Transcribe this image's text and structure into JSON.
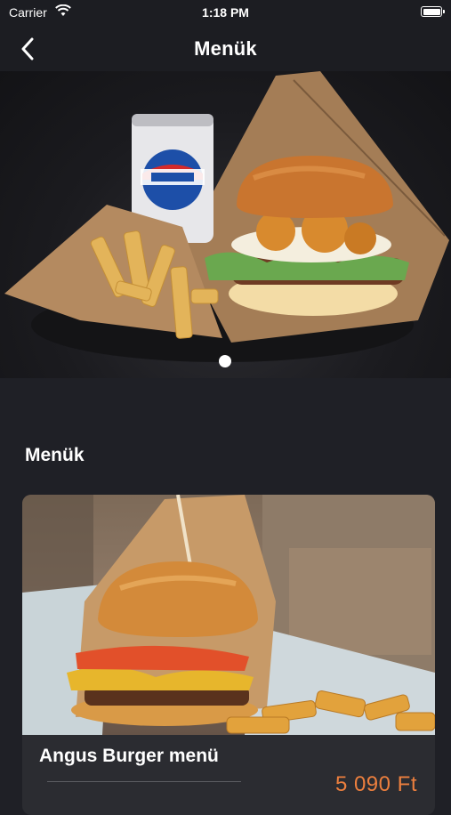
{
  "status_bar": {
    "carrier": "Carrier",
    "time": "1:18 PM",
    "icons": [
      "wifi-icon",
      "battery-icon"
    ]
  },
  "nav": {
    "title": "Menük",
    "back_icon": "chevron-left-icon"
  },
  "hero": {
    "images": [
      "pepsi-burger-fries-combo"
    ],
    "active_index": 0
  },
  "section": {
    "title": "Menük"
  },
  "menu_items": [
    {
      "name": "Angus Burger menü",
      "price": "5 090 Ft",
      "image": "angus-burger-fries"
    }
  ],
  "colors": {
    "background": "#1f2026",
    "card": "#2b2c31",
    "price": "#ec7f3e",
    "text": "#ffffff"
  }
}
